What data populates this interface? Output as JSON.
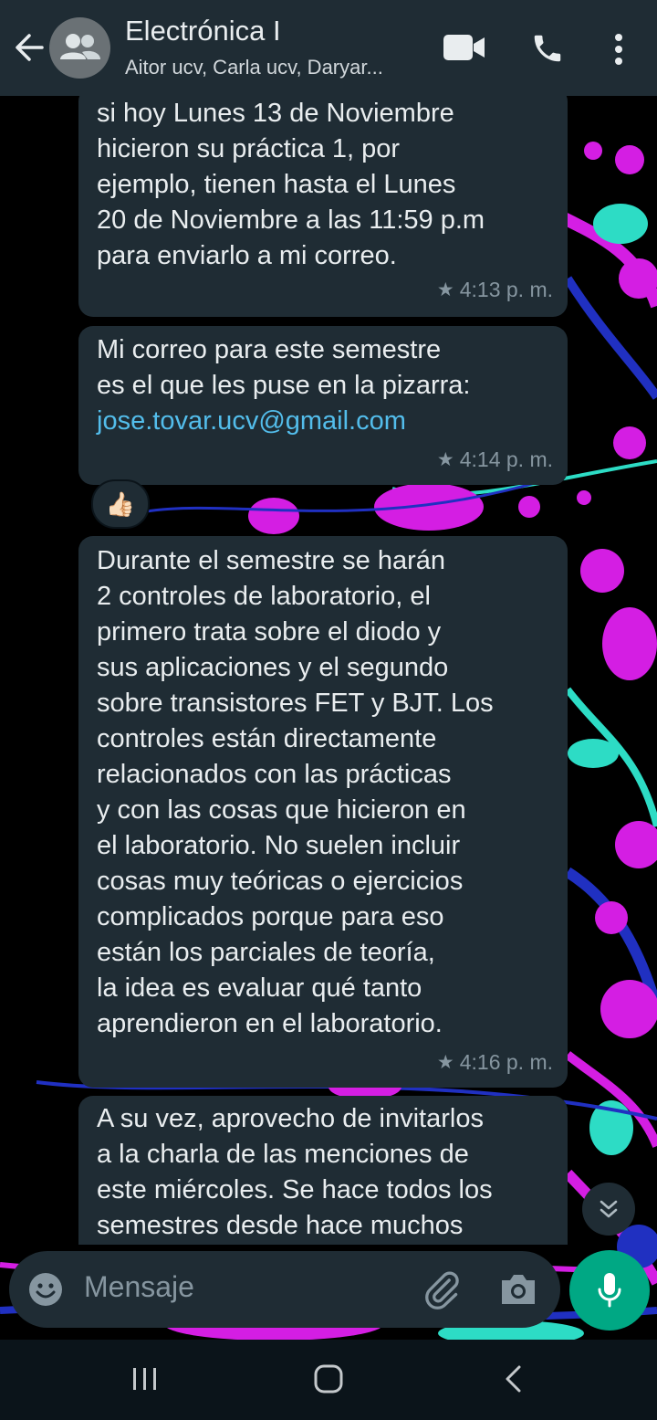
{
  "header": {
    "title": "Electrónica I",
    "subtitle": "Aitor ucv, Carla ucv, Daryar...",
    "icons": [
      "back-arrow-icon",
      "group-avatar-icon",
      "video-call-icon",
      "voice-call-icon",
      "more-options-icon"
    ]
  },
  "messages": [
    {
      "lines": [
        "si hoy Lunes 13 de Noviembre",
        "hicieron su práctica 1, por",
        "ejemplo, tienen hasta el Lunes",
        "20 de Noviembre a las 11:59 p.m",
        "para enviarlo a mi correo."
      ],
      "time": "4:13 p. m.",
      "starred": true
    },
    {
      "lines": [
        "Mi correo para este semestre",
        "es el que les puse en la pizarra:"
      ],
      "link": "jose.tovar.ucv@gmail.com",
      "time": "4:14 p. m.",
      "starred": true,
      "reaction": "👍🏻"
    },
    {
      "lines": [
        "Durante el semestre se harán",
        "2 controles de laboratorio, el",
        "primero trata sobre el diodo y",
        "sus aplicaciones y el segundo",
        "sobre transistores FET y BJT. Los",
        "controles están directamente",
        "relacionados con las prácticas",
        "y con las cosas que hicieron en",
        "el laboratorio. No suelen incluir",
        "cosas muy teóricas o ejercicios",
        "complicados porque para eso",
        "están los parciales de teoría,",
        "la idea es evaluar qué tanto",
        "aprendieron en el laboratorio."
      ],
      "time": "4:16 p. m.",
      "starred": true
    },
    {
      "lines": [
        "A su vez, aprovecho de invitarlos",
        "a la charla de las menciones de",
        "este miércoles. Se hace todos los",
        "semestres desde hace muchos"
      ],
      "time": "",
      "starred": false
    }
  ],
  "composer": {
    "placeholder": "Mensaje"
  },
  "colors": {
    "header_bg": "#1f2c34",
    "bubble_bg": "#1f2c34",
    "link": "#53bdeb",
    "accent": "#00a884",
    "wallpaper_magenta": "#e020f0",
    "wallpaper_cyan": "#30e8d0",
    "wallpaper_blue": "#2233cc"
  }
}
